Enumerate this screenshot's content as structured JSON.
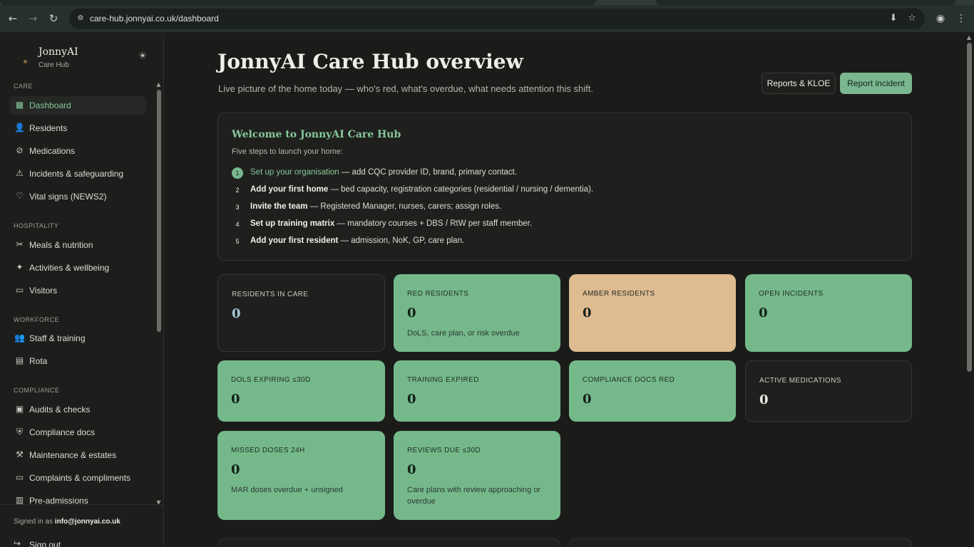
{
  "browser": {
    "url": "care-hub.jonnyai.co.uk/dashboard",
    "back_icon": "←",
    "forward_icon": "→",
    "reload_icon": "↻",
    "site_info_icon": "⚙",
    "install_icon": "⬇",
    "star_icon": "☆",
    "profile_icon": "◉",
    "menu_icon": "⋮"
  },
  "sidebar": {
    "brand_name": "JonnyAI",
    "brand_sub": "Care Hub",
    "theme_icon": "☀",
    "sections": [
      {
        "label": "CARE",
        "items": [
          {
            "label": "Dashboard",
            "icon": "▦",
            "active": true
          },
          {
            "label": "Residents",
            "icon": "👤"
          },
          {
            "label": "Medications",
            "icon": "⊘"
          },
          {
            "label": "Incidents & safeguarding",
            "icon": "⚠"
          },
          {
            "label": "Vital signs (NEWS2)",
            "icon": "♡"
          }
        ]
      },
      {
        "label": "HOSPITALITY",
        "items": [
          {
            "label": "Meals & nutrition",
            "icon": "✂"
          },
          {
            "label": "Activities & wellbeing",
            "icon": "✦"
          },
          {
            "label": "Visitors",
            "icon": "▭"
          }
        ]
      },
      {
        "label": "WORKFORCE",
        "items": [
          {
            "label": "Staff & training",
            "icon": "👥"
          },
          {
            "label": "Rota",
            "icon": "▤"
          }
        ]
      },
      {
        "label": "COMPLIANCE",
        "items": [
          {
            "label": "Audits & checks",
            "icon": "▣"
          },
          {
            "label": "Compliance docs",
            "icon": "⛨"
          },
          {
            "label": "Maintenance & estates",
            "icon": "⚒"
          },
          {
            "label": "Complaints & compliments",
            "icon": "▭"
          },
          {
            "label": "Pre-admissions",
            "icon": "▥"
          }
        ]
      }
    ],
    "signed_in_prefix": "Signed in as",
    "signed_in_email": "info@jonnyai.co.uk",
    "sign_out": "Sign out",
    "sign_out_icon": "↪"
  },
  "header": {
    "title": "JonnyAI Care Hub overview",
    "subtitle": "Live picture of the home today — who's red, what's overdue, what needs attention this shift.",
    "reports_button": "Reports & KLOE",
    "incident_button": "Report incident"
  },
  "welcome": {
    "title": "Welcome to JonnyAI Care Hub",
    "subtitle": "Five steps to launch your home:",
    "steps": [
      {
        "num": "1",
        "head": "Set up your organisation",
        "rest": " — add CQC provider ID, brand, primary contact."
      },
      {
        "num": "2",
        "head": "Add your first home",
        "rest": " — bed capacity, registration categories (residential / nursing / dementia)."
      },
      {
        "num": "3",
        "head": "Invite the team",
        "rest": " — Registered Manager, nurses, carers; assign roles."
      },
      {
        "num": "4",
        "head": "Set up training matrix",
        "rest": " — mandatory courses + DBS / RtW per staff member."
      },
      {
        "num": "5",
        "head": "Add your first resident",
        "rest": " — admission, NoK, GP, care plan."
      }
    ]
  },
  "stats": [
    {
      "label": "RESIDENTS IN CARE",
      "value": "0",
      "desc": "",
      "tone": "dark",
      "accent": "#a9c6d8"
    },
    {
      "label": "RED RESIDENTS",
      "value": "0",
      "desc": "DoLS, care plan, or risk overdue",
      "tone": "green"
    },
    {
      "label": "AMBER RESIDENTS",
      "value": "0",
      "desc": "",
      "tone": "amber"
    },
    {
      "label": "OPEN INCIDENTS",
      "value": "0",
      "desc": "",
      "tone": "green"
    },
    {
      "label": "DOLS EXPIRING ≤30D",
      "value": "0",
      "desc": "",
      "tone": "green"
    },
    {
      "label": "TRAINING EXPIRED",
      "value": "0",
      "desc": "",
      "tone": "green"
    },
    {
      "label": "COMPLIANCE DOCS RED",
      "value": "0",
      "desc": "",
      "tone": "green"
    },
    {
      "label": "ACTIVE MEDICATIONS",
      "value": "0",
      "desc": "",
      "tone": "dark"
    },
    {
      "label": "MISSED DOSES 24H",
      "value": "0",
      "desc": "MAR doses overdue + unsigned",
      "tone": "green"
    },
    {
      "label": "REVIEWS DUE ≤30D",
      "value": "0",
      "desc": "Care plans with review approaching or overdue",
      "tone": "green"
    }
  ],
  "colors": {
    "accent_green": "#7ab790",
    "card_green": "#75b98b",
    "card_amber": "#dfbb92",
    "background": "#1b1c1a"
  }
}
